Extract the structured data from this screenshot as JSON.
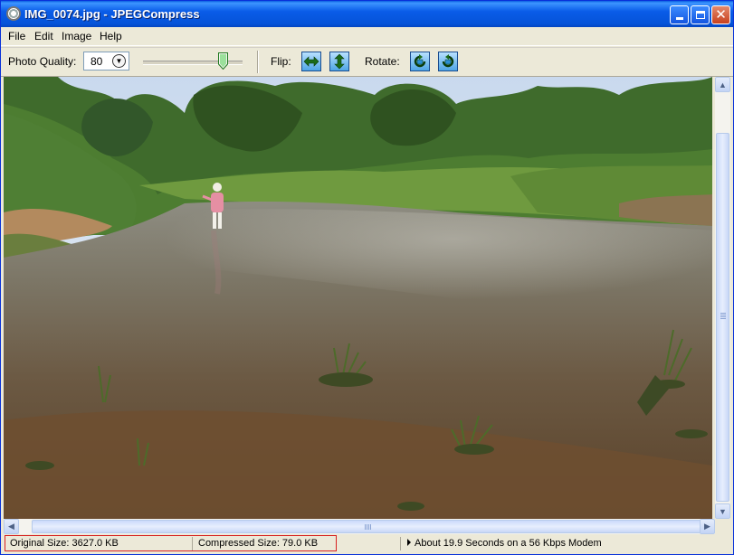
{
  "window": {
    "title": "IMG_0074.jpg - JPEGCompress",
    "app_icon": "camera-aperture-icon",
    "controls": [
      "minimize-icon",
      "maximize-icon",
      "close-icon"
    ]
  },
  "menu": {
    "file": "File",
    "edit": "Edit",
    "image": "Image",
    "help": "Help"
  },
  "toolbar": {
    "quality_label": "Photo Quality:",
    "quality_value": "80",
    "quality_slider_level": 0.8,
    "flip_label": "Flip:",
    "rotate_label": "Rotate:",
    "buttons": [
      "flip-horizontal-icon",
      "flip-vertical-icon",
      "rotate-left-icon",
      "rotate-right-icon"
    ]
  },
  "image_description_icon": "photo-river-scene",
  "status": {
    "original": "Original Size: 3627.0 KB",
    "compressed": "Compressed Size: 79.0 KB",
    "download_estimate": "About 19.9 Seconds on a 56 Kbps Modem"
  },
  "colors": {
    "titlebar": "#0553d8",
    "window_bg": "#ece9d8",
    "status_highlight": "#d62020"
  }
}
